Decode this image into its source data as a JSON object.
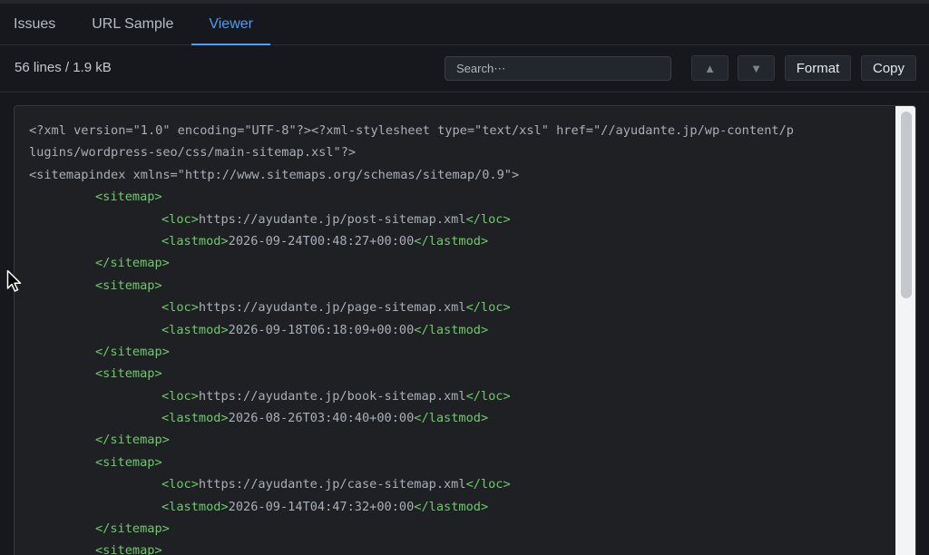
{
  "tabs": [
    {
      "label": "Issues",
      "active": false
    },
    {
      "label": "URL Sample",
      "active": false
    },
    {
      "label": "Viewer",
      "active": true
    }
  ],
  "toolbar": {
    "stats": "56 lines / 1.9 kB",
    "search_placeholder": "Search⋯",
    "prev_label": "▲",
    "next_label": "▼",
    "format_label": "Format",
    "copy_label": "Copy"
  },
  "viewer": {
    "lines": [
      {
        "indent": 0,
        "type": "text",
        "text": "<?xml version=\"1.0\" encoding=\"UTF-8\"?><?xml-stylesheet type=\"text/xsl\" href=\"//ayudante.jp/wp-content/p"
      },
      {
        "indent": 0,
        "type": "text",
        "text": "lugins/wordpress-seo/css/main-sitemap.xsl\"?>"
      },
      {
        "indent": 0,
        "type": "text",
        "text": "<sitemapindex xmlns=\"http://www.sitemaps.org/schemas/sitemap/0.9\">"
      },
      {
        "indent": 1,
        "type": "tag",
        "text": "<sitemap>"
      },
      {
        "indent": 2,
        "type": "elem",
        "open": "<loc>",
        "value": "https://ayudante.jp/post-sitemap.xml",
        "close": "</loc>"
      },
      {
        "indent": 2,
        "type": "elem",
        "open": "<lastmod>",
        "value": "2026-09-24T00:48:27+00:00",
        "close": "</lastmod>"
      },
      {
        "indent": 1,
        "type": "tag",
        "text": "</sitemap>"
      },
      {
        "indent": 1,
        "type": "tag",
        "text": "<sitemap>"
      },
      {
        "indent": 2,
        "type": "elem",
        "open": "<loc>",
        "value": "https://ayudante.jp/page-sitemap.xml",
        "close": "</loc>"
      },
      {
        "indent": 2,
        "type": "elem",
        "open": "<lastmod>",
        "value": "2026-09-18T06:18:09+00:00",
        "close": "</lastmod>"
      },
      {
        "indent": 1,
        "type": "tag",
        "text": "</sitemap>"
      },
      {
        "indent": 1,
        "type": "tag",
        "text": "<sitemap>"
      },
      {
        "indent": 2,
        "type": "elem",
        "open": "<loc>",
        "value": "https://ayudante.jp/book-sitemap.xml",
        "close": "</loc>"
      },
      {
        "indent": 2,
        "type": "elem",
        "open": "<lastmod>",
        "value": "2026-08-26T03:40:40+00:00",
        "close": "</lastmod>"
      },
      {
        "indent": 1,
        "type": "tag",
        "text": "</sitemap>"
      },
      {
        "indent": 1,
        "type": "tag",
        "text": "<sitemap>"
      },
      {
        "indent": 2,
        "type": "elem",
        "open": "<loc>",
        "value": "https://ayudante.jp/case-sitemap.xml",
        "close": "</loc>"
      },
      {
        "indent": 2,
        "type": "elem",
        "open": "<lastmod>",
        "value": "2026-09-14T04:47:32+00:00",
        "close": "</lastmod>"
      },
      {
        "indent": 1,
        "type": "tag",
        "text": "</sitemap>"
      },
      {
        "indent": 1,
        "type": "tag",
        "text": "<sitemap>"
      }
    ]
  },
  "colors": {
    "accent": "#4b9ff5",
    "xml_tag": "#6fca6a",
    "xml_text": "#a9afb8",
    "background": "#16181d"
  },
  "icons": {
    "cursor": "mouse-pointer-icon",
    "prev": "arrow-up-icon",
    "next": "arrow-down-icon"
  }
}
